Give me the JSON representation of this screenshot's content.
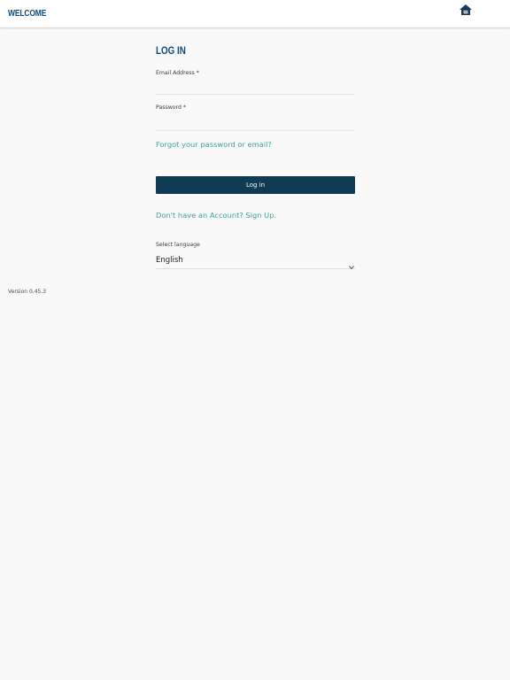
{
  "header": {
    "title": "WELCOME",
    "logo_icon": "equal-housing-opportunity-logo",
    "logo_text_lines": [
      "EQUAL",
      "HOUSING",
      "OPPORTUNITY"
    ]
  },
  "login": {
    "heading": "LOG IN",
    "email_label": "Email Address *",
    "email_value": "",
    "password_label": "Password *",
    "password_value": "",
    "forgot_link": "Forgot your password or email?",
    "submit_label": "Log in",
    "signup_link": "Don't have an Account? Sign Up.",
    "language_label": "Select language",
    "language_value": "English"
  },
  "footer": {
    "version": "Version 0.45.3"
  },
  "colors": {
    "brand_blue": "#0e4b7a",
    "button_dark": "#0f3b54",
    "link_teal": "#3c9ea0",
    "background": "#f9f9f9"
  }
}
